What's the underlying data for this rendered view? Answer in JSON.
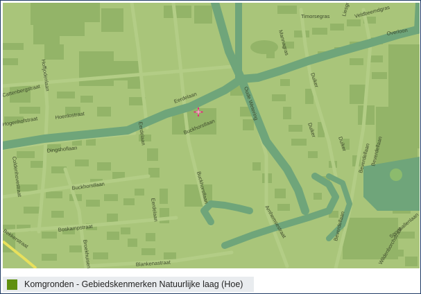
{
  "map": {
    "colors": {
      "land": "#a9c57a",
      "water": "#6fa57a",
      "building": "#93b468",
      "road_edge": "#9cba6f",
      "road_light": "#b3cd86",
      "marker": "#e0307a"
    },
    "street_labels": [
      "Timorsegras",
      "Liesgras",
      "Veldbeemdgras",
      "Overloon",
      "Mannagras",
      "Hoffjodenlaan",
      "Cattenbergstraat",
      "Eerdelaan",
      "Oude Wetering",
      "Duiker",
      "Hoenlostraat",
      "Hogenhofstraat",
      "Buckhorstlaan",
      "Eerdelaan",
      "Duiker",
      "Dingshoflaan",
      "Duiker",
      "Coldenhovestraat",
      "Buckhorstlaan",
      "Eerdelaan",
      "Buckhorstlaan",
      "Beverdellaan",
      "Beverdellaan",
      "Bekkerstraat",
      "Boskampstraat",
      "Broekhuisenstraat",
      "Arnhemsestraat",
      "Beverdellaan",
      "Blankenastraat",
      "Wildenborchstraat",
      "Sporthallenlaan"
    ],
    "marker_icon": "location-cross-icon"
  },
  "legend": {
    "swatch_color": "#5f8f0f",
    "label": "Komgronden - Gebiedskenmerken Natuurlijke laag (Hoe)"
  }
}
